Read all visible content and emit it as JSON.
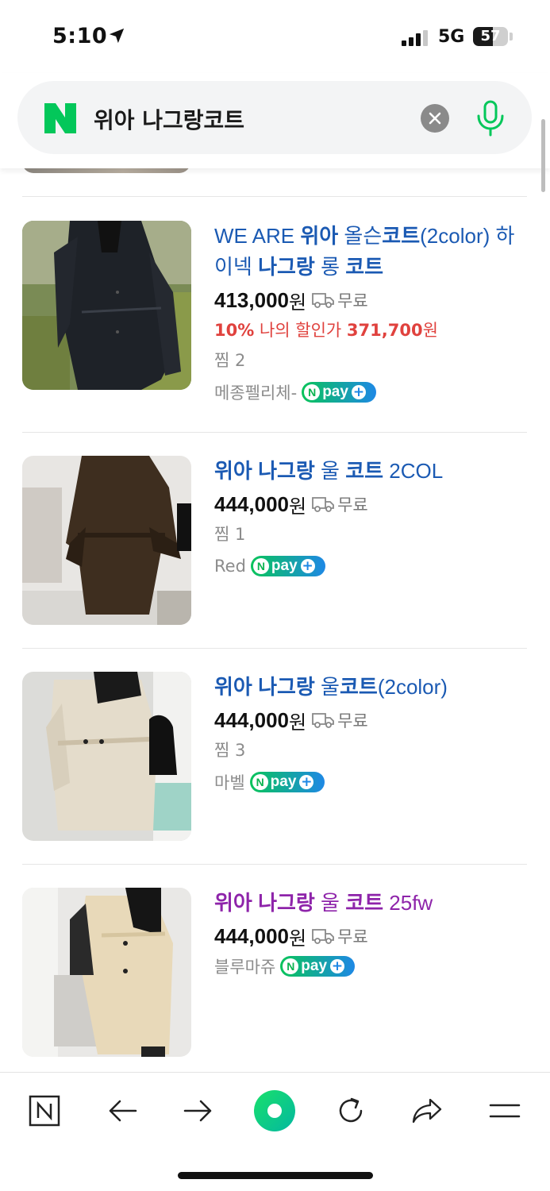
{
  "status_bar": {
    "time": "5:10",
    "network": "5G",
    "battery": "57",
    "battery_level": 0.57
  },
  "search": {
    "query": "위아 나그랑코트"
  },
  "products": [
    {
      "title_segments": [
        {
          "text": "WE ARE ",
          "bold": false
        },
        {
          "text": "위아",
          "bold": true
        },
        {
          "text": " 올슨",
          "bold": false
        },
        {
          "text": "코트",
          "bold": true
        },
        {
          "text": "(2color) 하이넥 ",
          "bold": false
        },
        {
          "text": "나그랑",
          "bold": true
        },
        {
          "text": " 롱 ",
          "bold": false
        },
        {
          "text": "코트",
          "bold": true
        }
      ],
      "visited": false,
      "price": "413,000",
      "price_unit": "원",
      "shipping": "무료",
      "discount": {
        "percent": "10%",
        "label": " 나의 할인가 ",
        "price": "371,700",
        "unit": "원"
      },
      "zzim": "찜 2",
      "seller": "메종펠리체-",
      "npay": true
    },
    {
      "title_segments": [
        {
          "text": "위아 나그랑",
          "bold": true
        },
        {
          "text": " 울 ",
          "bold": false
        },
        {
          "text": "코트",
          "bold": true
        },
        {
          "text": " 2COL",
          "bold": false
        }
      ],
      "visited": false,
      "price": "444,000",
      "price_unit": "원",
      "shipping": "무료",
      "zzim": "찜 1",
      "seller": "Red",
      "npay": true
    },
    {
      "title_segments": [
        {
          "text": "위아 나그랑",
          "bold": true
        },
        {
          "text": " 울",
          "bold": false
        },
        {
          "text": "코트",
          "bold": true
        },
        {
          "text": "(2color)",
          "bold": false
        }
      ],
      "visited": false,
      "price": "444,000",
      "price_unit": "원",
      "shipping": "무료",
      "zzim": "찜 3",
      "seller": "마벨",
      "npay": true
    },
    {
      "title_segments": [
        {
          "text": "위아 나그랑",
          "bold": true
        },
        {
          "text": " 울 ",
          "bold": false
        },
        {
          "text": "코트",
          "bold": true
        },
        {
          "text": " 25fw",
          "bold": false
        }
      ],
      "visited": true,
      "price": "444,000",
      "price_unit": "원",
      "shipping": "무료",
      "seller": "블루마쥬",
      "npay": true
    }
  ],
  "npay_badge": {
    "n": "N",
    "text": "pay",
    "plus": "+"
  },
  "toolbar": {
    "items": [
      "naver-home-icon",
      "back-arrow-icon",
      "forward-arrow-icon",
      "green-dot-icon",
      "refresh-icon",
      "share-icon",
      "menu-icon"
    ]
  },
  "colors": {
    "title_link": "#1b5ab3",
    "title_visited": "#8e24aa",
    "discount": "#e0423e",
    "naver_green": "#03c75a"
  }
}
